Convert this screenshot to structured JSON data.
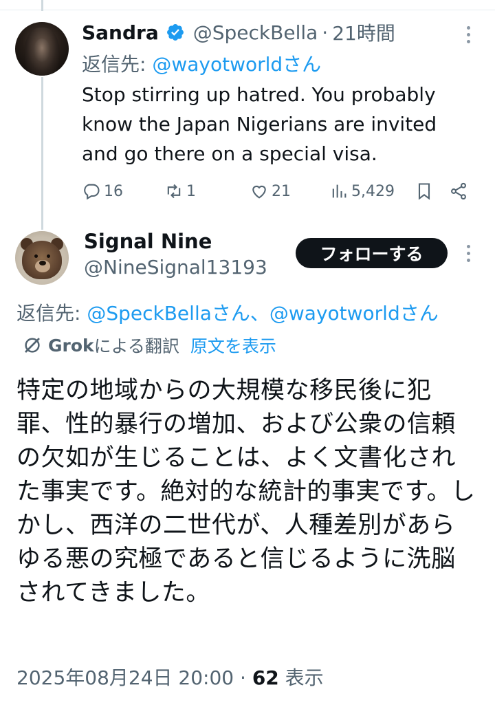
{
  "reply_tweet": {
    "display_name": "Sandra",
    "handle": "@SpeckBella",
    "separator": "·",
    "time": "21時間",
    "reply_to_prefix": "返信先: ",
    "reply_to_mention": "@wayotworldさん",
    "body": "Stop stirring up hatred. You probably know the Japan Nigerians are invited and go there on a special visa.",
    "actions": {
      "replies": "16",
      "retweets": "1",
      "likes": "21",
      "views": "5,429"
    }
  },
  "main_tweet": {
    "display_name": "Signal Nine",
    "handle": "@NineSignal13193",
    "follow_label": "フォローする",
    "reply_to_prefix": "返信先: ",
    "reply_to_mentions": "@SpeckBellaさん、@wayotworldさん",
    "translation_label": "Grok",
    "translation_suffix": "による翻訳",
    "show_original_label": "原文を表示",
    "body": "特定の地域からの大規模な移民後に犯罪、性的暴行の増加、および公衆の信頼の欠如が生じることは、よく文書化された事実です。絶対的な統計的事実です。しかし、西洋の二世代が、人種差別があらゆる悪の究極であると信じるように洗脳されてきました。",
    "timestamp": "2025年08月24日 20:00",
    "separator": " · ",
    "views_count": "62",
    "views_label": " 表示"
  },
  "colors": {
    "text": "#0f1419",
    "secondary": "#536471",
    "accent": "#1d9bf0",
    "follow_bg": "#0f1419"
  },
  "icons": [
    "verified-badge-icon",
    "reply-icon",
    "retweet-icon",
    "like-icon",
    "views-icon",
    "bookmark-icon",
    "share-icon",
    "more-icon",
    "grok-icon"
  ]
}
